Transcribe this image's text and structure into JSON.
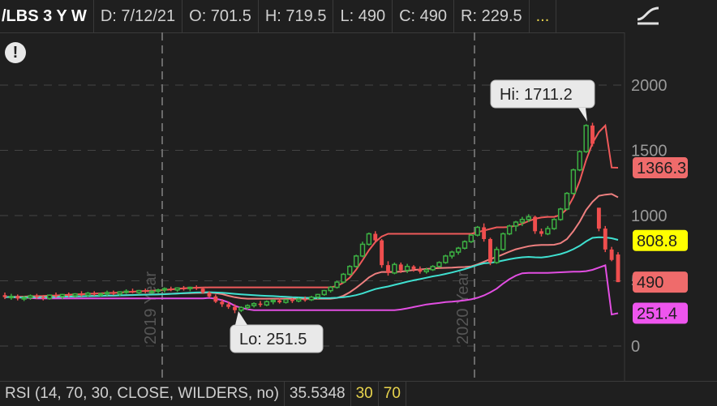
{
  "header": {
    "symbol": "/LBS 3 Y W",
    "date": "D: 7/12/21",
    "open": "O: 701.5",
    "high": "H: 719.5",
    "low": "L: 490",
    "close": "C: 490",
    "range": "R: 229.5",
    "more": "..."
  },
  "icons": {
    "studies": "studies-icon",
    "alert": "alert-icon"
  },
  "alert_glyph": "!",
  "chart_data": {
    "type": "candlestick",
    "y_ticks": [
      "2000",
      "1500",
      "1000",
      "500",
      "0"
    ],
    "ylim": [
      -100,
      2250
    ],
    "period_labels": [
      "2019 Year",
      "2020 Year"
    ],
    "callouts": {
      "high": "Hi: 1711.2",
      "low": "Lo: 251.5"
    },
    "price_tags": [
      {
        "label": "1366.3",
        "value": 1366.3,
        "color": "#ef6b6b",
        "text_color": "#1f1f1f"
      },
      {
        "label": "808.8",
        "value": 808.8,
        "color": "#ffff00",
        "text_color": "#1f1f1f"
      },
      {
        "label": "490",
        "value": 490,
        "color": "#ef6b6b",
        "text_color": "#1f1f1f"
      },
      {
        "label": "251.4",
        "value": 251.4,
        "color": "#ee55ee",
        "text_color": "#1f1f1f"
      }
    ],
    "candles": [
      {
        "o": 390,
        "h": 410,
        "l": 360,
        "c": 375
      },
      {
        "o": 375,
        "h": 400,
        "l": 355,
        "c": 380
      },
      {
        "o": 380,
        "h": 395,
        "l": 350,
        "c": 365
      },
      {
        "o": 365,
        "h": 385,
        "l": 345,
        "c": 370
      },
      {
        "o": 370,
        "h": 395,
        "l": 355,
        "c": 385
      },
      {
        "o": 385,
        "h": 400,
        "l": 360,
        "c": 375
      },
      {
        "o": 375,
        "h": 390,
        "l": 350,
        "c": 365
      },
      {
        "o": 365,
        "h": 395,
        "l": 355,
        "c": 390
      },
      {
        "o": 390,
        "h": 410,
        "l": 370,
        "c": 380
      },
      {
        "o": 380,
        "h": 400,
        "l": 360,
        "c": 395
      },
      {
        "o": 395,
        "h": 410,
        "l": 375,
        "c": 385
      },
      {
        "o": 385,
        "h": 405,
        "l": 370,
        "c": 400
      },
      {
        "o": 400,
        "h": 420,
        "l": 380,
        "c": 390
      },
      {
        "o": 390,
        "h": 415,
        "l": 375,
        "c": 405
      },
      {
        "o": 405,
        "h": 420,
        "l": 385,
        "c": 395
      },
      {
        "o": 395,
        "h": 410,
        "l": 380,
        "c": 400
      },
      {
        "o": 400,
        "h": 425,
        "l": 385,
        "c": 410
      },
      {
        "o": 410,
        "h": 425,
        "l": 390,
        "c": 400
      },
      {
        "o": 400,
        "h": 420,
        "l": 385,
        "c": 415
      },
      {
        "o": 415,
        "h": 435,
        "l": 400,
        "c": 420
      },
      {
        "o": 420,
        "h": 440,
        "l": 405,
        "c": 410
      },
      {
        "o": 410,
        "h": 430,
        "l": 395,
        "c": 425
      },
      {
        "o": 425,
        "h": 440,
        "l": 405,
        "c": 415
      },
      {
        "o": 415,
        "h": 430,
        "l": 400,
        "c": 420
      },
      {
        "o": 420,
        "h": 440,
        "l": 405,
        "c": 430
      },
      {
        "o": 430,
        "h": 450,
        "l": 410,
        "c": 440
      },
      {
        "o": 440,
        "h": 455,
        "l": 420,
        "c": 430
      },
      {
        "o": 430,
        "h": 450,
        "l": 415,
        "c": 445
      },
      {
        "o": 445,
        "h": 460,
        "l": 425,
        "c": 440
      },
      {
        "o": 440,
        "h": 455,
        "l": 420,
        "c": 450
      },
      {
        "o": 450,
        "h": 465,
        "l": 430,
        "c": 440
      },
      {
        "o": 440,
        "h": 450,
        "l": 400,
        "c": 410
      },
      {
        "o": 410,
        "h": 420,
        "l": 370,
        "c": 380
      },
      {
        "o": 380,
        "h": 395,
        "l": 330,
        "c": 340
      },
      {
        "o": 340,
        "h": 360,
        "l": 300,
        "c": 320
      },
      {
        "o": 320,
        "h": 340,
        "l": 285,
        "c": 300
      },
      {
        "o": 300,
        "h": 320,
        "l": 252,
        "c": 275
      },
      {
        "o": 275,
        "h": 305,
        "l": 260,
        "c": 295
      },
      {
        "o": 295,
        "h": 320,
        "l": 280,
        "c": 310
      },
      {
        "o": 310,
        "h": 335,
        "l": 295,
        "c": 325
      },
      {
        "o": 325,
        "h": 345,
        "l": 300,
        "c": 315
      },
      {
        "o": 315,
        "h": 350,
        "l": 305,
        "c": 340
      },
      {
        "o": 340,
        "h": 360,
        "l": 320,
        "c": 350
      },
      {
        "o": 350,
        "h": 365,
        "l": 325,
        "c": 335
      },
      {
        "o": 335,
        "h": 360,
        "l": 325,
        "c": 355
      },
      {
        "o": 355,
        "h": 370,
        "l": 330,
        "c": 345
      },
      {
        "o": 345,
        "h": 370,
        "l": 335,
        "c": 360
      },
      {
        "o": 360,
        "h": 380,
        "l": 340,
        "c": 355
      },
      {
        "o": 355,
        "h": 385,
        "l": 345,
        "c": 375
      },
      {
        "o": 375,
        "h": 400,
        "l": 360,
        "c": 395
      },
      {
        "o": 395,
        "h": 430,
        "l": 385,
        "c": 425
      },
      {
        "o": 425,
        "h": 460,
        "l": 410,
        "c": 450
      },
      {
        "o": 450,
        "h": 500,
        "l": 440,
        "c": 490
      },
      {
        "o": 490,
        "h": 560,
        "l": 480,
        "c": 550
      },
      {
        "o": 550,
        "h": 620,
        "l": 540,
        "c": 610
      },
      {
        "o": 610,
        "h": 700,
        "l": 600,
        "c": 690
      },
      {
        "o": 690,
        "h": 800,
        "l": 680,
        "c": 780
      },
      {
        "o": 780,
        "h": 870,
        "l": 770,
        "c": 860
      },
      {
        "o": 860,
        "h": 880,
        "l": 800,
        "c": 810
      },
      {
        "o": 810,
        "h": 820,
        "l": 600,
        "c": 620
      },
      {
        "o": 620,
        "h": 650,
        "l": 540,
        "c": 560
      },
      {
        "o": 560,
        "h": 640,
        "l": 550,
        "c": 625
      },
      {
        "o": 625,
        "h": 640,
        "l": 560,
        "c": 580
      },
      {
        "o": 580,
        "h": 630,
        "l": 560,
        "c": 610
      },
      {
        "o": 610,
        "h": 620,
        "l": 570,
        "c": 590
      },
      {
        "o": 590,
        "h": 610,
        "l": 555,
        "c": 570
      },
      {
        "o": 570,
        "h": 600,
        "l": 555,
        "c": 585
      },
      {
        "o": 585,
        "h": 620,
        "l": 575,
        "c": 610
      },
      {
        "o": 610,
        "h": 650,
        "l": 600,
        "c": 640
      },
      {
        "o": 640,
        "h": 700,
        "l": 630,
        "c": 690
      },
      {
        "o": 690,
        "h": 730,
        "l": 670,
        "c": 720
      },
      {
        "o": 720,
        "h": 760,
        "l": 700,
        "c": 750
      },
      {
        "o": 750,
        "h": 810,
        "l": 740,
        "c": 800
      },
      {
        "o": 800,
        "h": 860,
        "l": 790,
        "c": 850
      },
      {
        "o": 850,
        "h": 920,
        "l": 840,
        "c": 910
      },
      {
        "o": 910,
        "h": 940,
        "l": 800,
        "c": 820
      },
      {
        "o": 820,
        "h": 830,
        "l": 620,
        "c": 640
      },
      {
        "o": 640,
        "h": 760,
        "l": 630,
        "c": 740
      },
      {
        "o": 740,
        "h": 870,
        "l": 730,
        "c": 860
      },
      {
        "o": 860,
        "h": 930,
        "l": 850,
        "c": 920
      },
      {
        "o": 920,
        "h": 960,
        "l": 880,
        "c": 950
      },
      {
        "o": 950,
        "h": 990,
        "l": 920,
        "c": 970
      },
      {
        "o": 970,
        "h": 1010,
        "l": 950,
        "c": 990
      },
      {
        "o": 990,
        "h": 1000,
        "l": 860,
        "c": 880
      },
      {
        "o": 880,
        "h": 900,
        "l": 840,
        "c": 860
      },
      {
        "o": 860,
        "h": 920,
        "l": 850,
        "c": 900
      },
      {
        "o": 900,
        "h": 980,
        "l": 890,
        "c": 970
      },
      {
        "o": 970,
        "h": 1060,
        "l": 960,
        "c": 1050
      },
      {
        "o": 1050,
        "h": 1180,
        "l": 1040,
        "c": 1170
      },
      {
        "o": 1170,
        "h": 1360,
        "l": 1160,
        "c": 1350
      },
      {
        "o": 1350,
        "h": 1500,
        "l": 1340,
        "c": 1490
      },
      {
        "o": 1490,
        "h": 1700,
        "l": 1480,
        "c": 1690
      },
      {
        "o": 1690,
        "h": 1711.2,
        "l": 1530,
        "c": 1550
      },
      {
        "o": 1060,
        "h": 1060,
        "l": 880,
        "c": 900
      },
      {
        "o": 900,
        "h": 920,
        "l": 720,
        "c": 740
      },
      {
        "o": 740,
        "h": 760,
        "l": 650,
        "c": 660
      },
      {
        "o": 701.5,
        "h": 719.5,
        "l": 490,
        "c": 490
      }
    ],
    "upper_band": [
      1366.3
    ],
    "lower_band": [
      251.4
    ],
    "moving_average": [
      808.8
    ]
  },
  "footer": {
    "study": "RSI (14, 70, 30, CLOSE, WILDERS, no)",
    "value": "35.5348",
    "oversold": "30",
    "overbought": "70"
  }
}
